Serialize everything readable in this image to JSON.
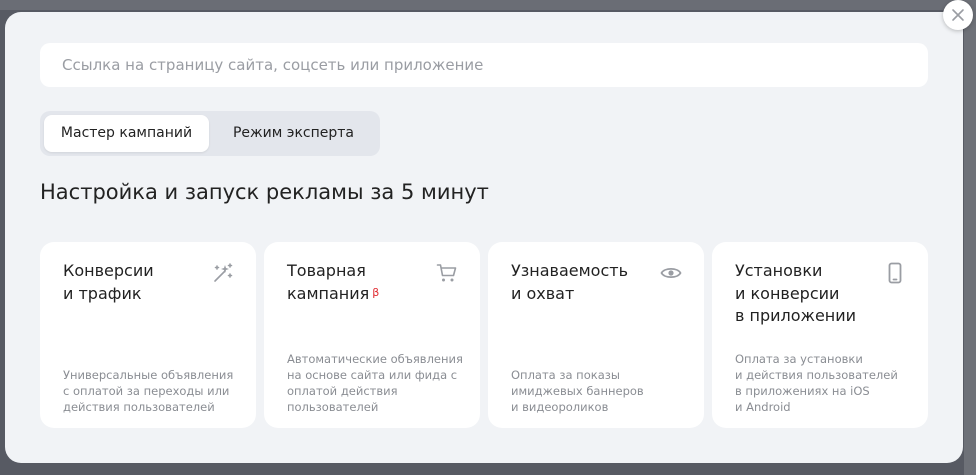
{
  "search": {
    "placeholder": "Ссылка на страницу сайта, соцсеть или приложение",
    "value": ""
  },
  "mode_switch": {
    "tabs": [
      {
        "label": "Мастер кампаний",
        "active": true
      },
      {
        "label": "Режим эксперта",
        "active": false
      }
    ]
  },
  "heading": "Настройка и запуск рекламы за 5 минут",
  "cards": [
    {
      "title": "Конверсии\nи трафик",
      "icon": "magic-wand-icon",
      "beta": "",
      "description": "Универсальные объявления\nс оплатой за переходы или\nдействия пользователей"
    },
    {
      "title": "Товарная\nкампания",
      "icon": "shopping-cart-icon",
      "beta": "β",
      "description": "Автоматические объявления\nна основе сайта или фида с\nоплатой действия\nпользователей"
    },
    {
      "title": "Узнаваемость\nи охват",
      "icon": "eye-icon",
      "beta": "",
      "description": "Оплата за показы\nимиджевых баннеров\nи видеороликов"
    },
    {
      "title": "Установки\nи конверсии\nв приложении",
      "icon": "smartphone-icon",
      "beta": "",
      "description": "Оплата за установки\nи действия пользователей\nв приложениях на iOS\nи Android"
    }
  ],
  "colors": {
    "overlay": "#575a63",
    "modal_bg": "#f1f3f6",
    "card_bg": "#ffffff",
    "beta": "#e0282e",
    "icon": "#9a9da3"
  }
}
